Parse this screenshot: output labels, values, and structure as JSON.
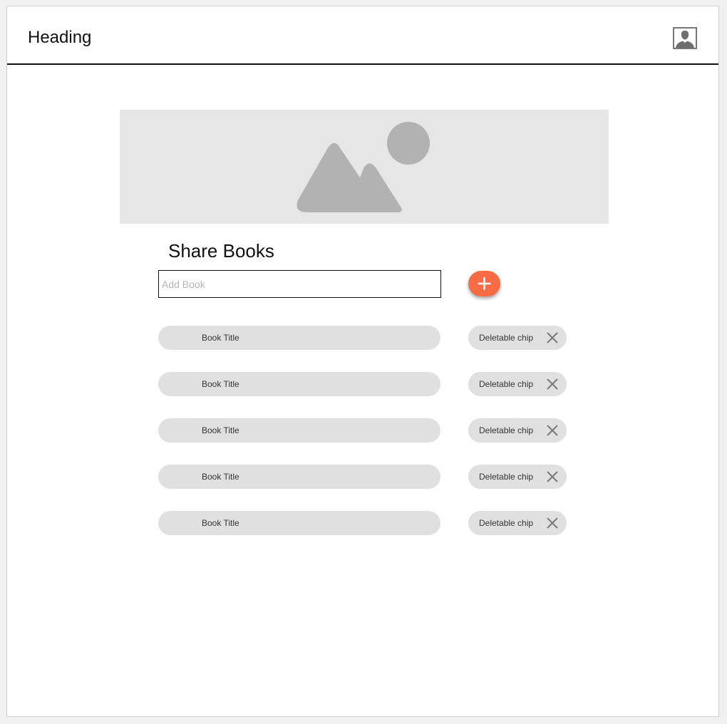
{
  "header": {
    "heading": "Heading",
    "avatar_icon": "user-avatar-icon"
  },
  "hero": {
    "icon": "image-placeholder-icon"
  },
  "main": {
    "title": "Share Books",
    "add_book_placeholder": "Add Book",
    "add_button_icon": "plus-icon"
  },
  "books": [
    {
      "title": "Book Title",
      "chip": "Deletable chip"
    },
    {
      "title": "Book Title",
      "chip": "Deletable chip"
    },
    {
      "title": "Book Title",
      "chip": "Deletable chip"
    },
    {
      "title": "Book Title",
      "chip": "Deletable chip"
    },
    {
      "title": "Book Title",
      "chip": "Deletable chip"
    }
  ],
  "colors": {
    "accent": "#f96b45",
    "pill": "#e0e0e0",
    "hero_bg": "#e6e6e6",
    "hero_glyph": "#b2b2b2"
  }
}
